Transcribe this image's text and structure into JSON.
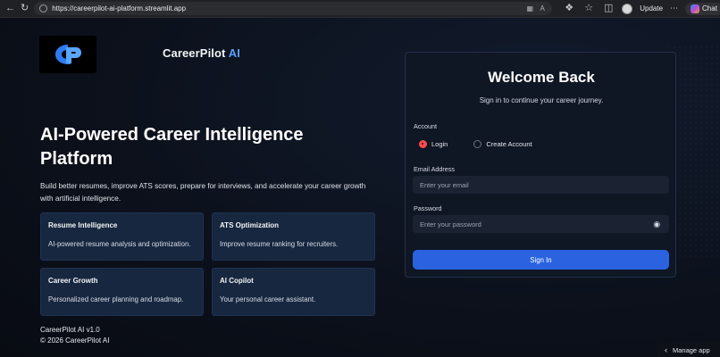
{
  "browser": {
    "url": "https://careerpilot-ai-platform.streamlit.app",
    "update_label": "Update",
    "chat_label": "Chat",
    "nav_icons": [
      "back-icon",
      "refresh-icon",
      "site-info-icon"
    ],
    "action_icons": [
      "apps-icon",
      "reader-icon",
      "extensions-icon",
      "favorites-icon"
    ]
  },
  "brand": {
    "name": "CareerPilot",
    "name_suffix": "AI",
    "accent": "#5aa0ff"
  },
  "hero": {
    "title": "AI-Powered Career Intelligence Platform",
    "subtitle": "Build better resumes, improve ATS scores, prepare for interviews, and accelerate your career growth with artificial intelligence."
  },
  "features": [
    {
      "title": "Resume Intelligence",
      "desc": "AI-powered resume analysis and optimization."
    },
    {
      "title": "ATS Optimization",
      "desc": "Improve resume ranking for recruiters."
    },
    {
      "title": "Career Growth",
      "desc": "Personalized career planning and roadmap."
    },
    {
      "title": "AI Copilot",
      "desc": "Your personal career assistant."
    }
  ],
  "footer": {
    "version": "CareerPilot AI v1.0",
    "copyright": "© 2026 CareerPilot AI"
  },
  "login": {
    "title": "Welcome Back",
    "subtitle": "Sign in to continue your career journey.",
    "account_label": "Account",
    "options": [
      "Login",
      "Create Account"
    ],
    "selected_option": "Login",
    "email_label": "Email Address",
    "email_placeholder": "Enter your email",
    "password_label": "Password",
    "password_placeholder": "Enter your password",
    "sign_in_label": "Sign In",
    "button_color": "#2a62e0",
    "radio_color": "#ff4b4b"
  },
  "manage_app": {
    "label": "Manage app"
  }
}
